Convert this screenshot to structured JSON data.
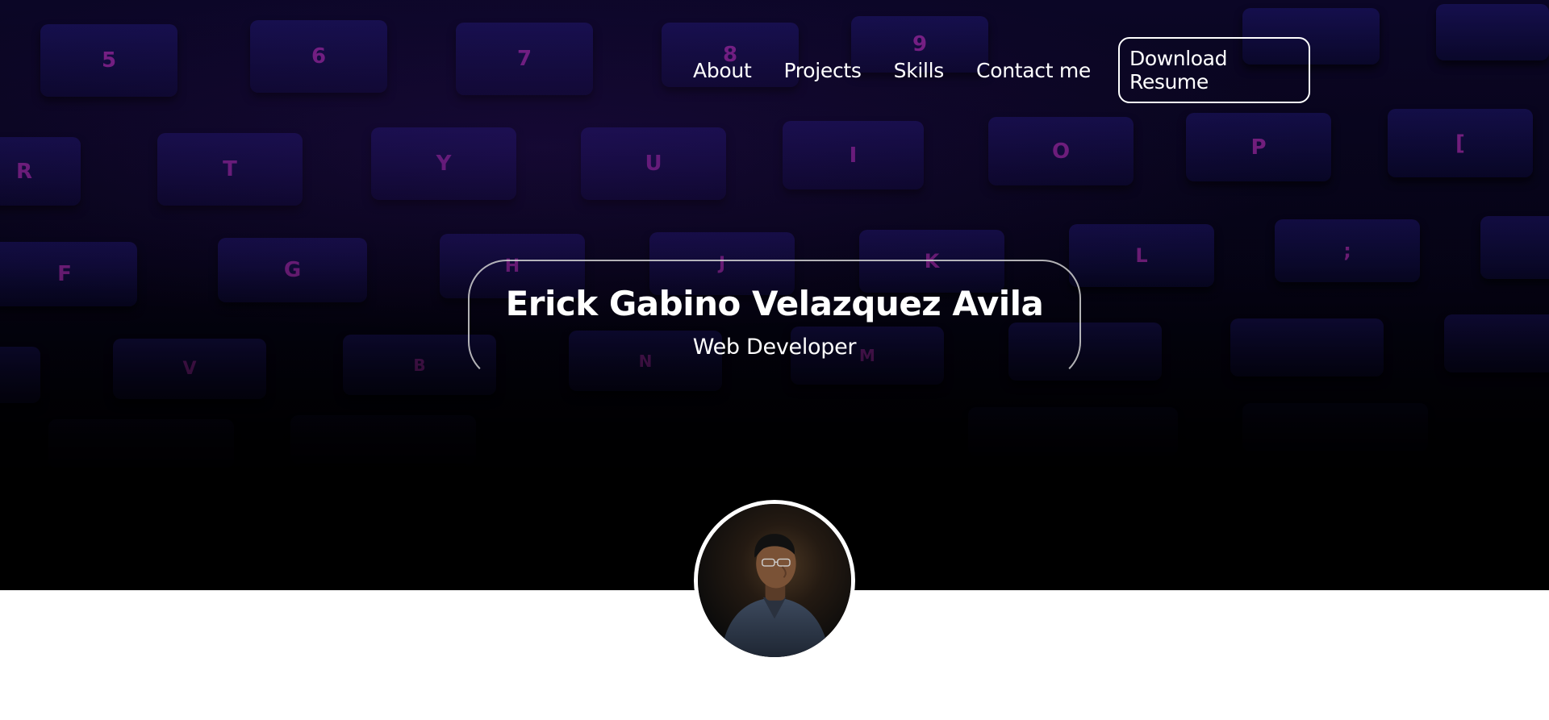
{
  "nav": {
    "links": [
      "About",
      "Projects",
      "Skills",
      "Contact me"
    ],
    "resume_label": "Download Resume"
  },
  "hero": {
    "name": "Erick Gabino Velazquez Avila",
    "role": "Web Developer",
    "keyboard_legends": [
      "5",
      "6",
      "7",
      "8",
      "9",
      "R",
      "T",
      "Y",
      "U",
      "I",
      "O",
      "P",
      "[",
      "F",
      "G",
      "H",
      "J",
      "K",
      "L",
      ";",
      "V",
      "B",
      "N",
      "M"
    ]
  },
  "colors": {
    "hero_top": "#0b0626",
    "hero_bottom": "#000000",
    "key_face": "#18125a",
    "key_legend": "#a028a0",
    "text": "#ffffff",
    "page_bg": "#ffffff"
  },
  "icons": {
    "avatar": "profile-photo"
  }
}
